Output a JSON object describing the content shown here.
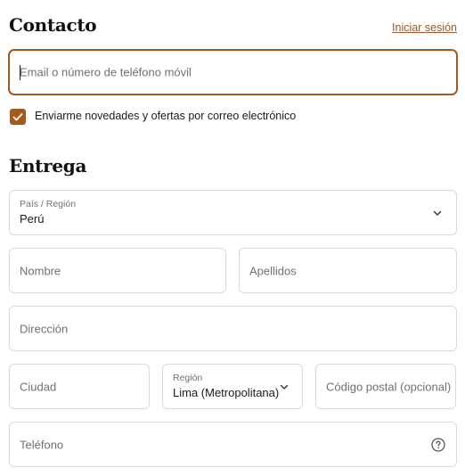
{
  "contact": {
    "title": "Contacto",
    "login_link": "Iniciar sesión",
    "email_placeholder": "Email o número de teléfono móvil",
    "newsletter_label": "Enviarme novedades y ofertas por correo electrónico",
    "newsletter_checked": true
  },
  "delivery": {
    "title": "Entrega",
    "country": {
      "label": "País / Región",
      "value": "Perú"
    },
    "first_name_placeholder": "Nombre",
    "last_name_placeholder": "Apellidos",
    "address_placeholder": "Dirección",
    "city_placeholder": "Ciudad",
    "region": {
      "label": "Región",
      "value": "Lima (Metropolitana)"
    },
    "postal_placeholder": "Código postal (opcional)",
    "phone_placeholder": "Teléfono"
  },
  "colors": {
    "accent": "#a25a1f",
    "link": "#9a5a2c",
    "border": "#d9d9d9"
  },
  "icons": {
    "checkbox": "check-icon",
    "select": "chevron-down-icon",
    "phone_help": "help-circle-icon"
  }
}
